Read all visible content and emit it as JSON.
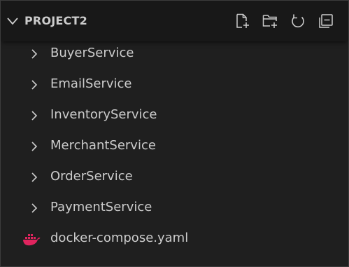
{
  "explorer": {
    "section_title": "PROJECT2",
    "actions": [
      {
        "icon": "new-file-icon"
      },
      {
        "icon": "new-folder-icon"
      },
      {
        "icon": "refresh-icon"
      },
      {
        "icon": "collapse-all-icon"
      }
    ]
  },
  "tree": {
    "folders": [
      {
        "label": "BuyerService"
      },
      {
        "label": "EmailService"
      },
      {
        "label": "InventoryService"
      },
      {
        "label": "MerchantService"
      },
      {
        "label": "OrderService"
      },
      {
        "label": "PaymentService"
      }
    ],
    "files": [
      {
        "label": "docker-compose.yaml",
        "icon": "docker-icon"
      }
    ]
  },
  "colors": {
    "background": "#1f1f1f",
    "header_background": "#181818",
    "text": "#cccccc",
    "docker_icon": "#e0245e"
  }
}
